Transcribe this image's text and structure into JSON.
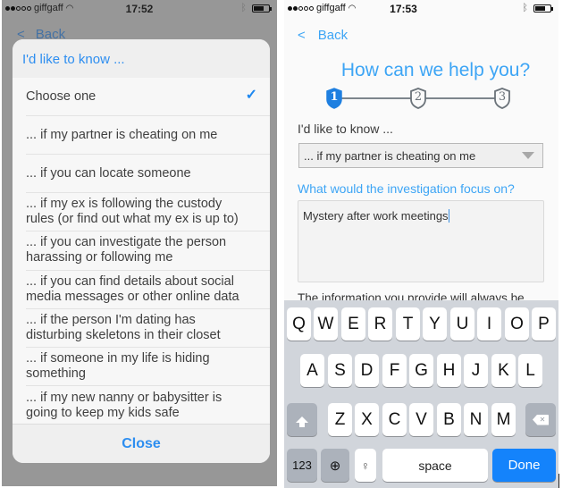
{
  "left_screen": {
    "status_bar": {
      "carrier": "giffgaff",
      "signal_bars_filled": 2,
      "signal_bars_total": 5,
      "time": "17:52"
    },
    "back_label": "Back",
    "picker": {
      "header": "I'd like to know ...",
      "options": [
        {
          "label": "Choose one",
          "selected": true
        },
        {
          "label": "... if my partner is cheating on me",
          "selected": false
        },
        {
          "label": "... if you can locate someone",
          "selected": false
        },
        {
          "label": "... if my ex is following the custody rules (or find out what my ex is up to)",
          "selected": false
        },
        {
          "label": "... if you can investigate the person harassing or following me",
          "selected": false
        },
        {
          "label": "... if you can find details about social media messages or other online data",
          "selected": false
        },
        {
          "label": "... if the person I'm dating has disturbing skeletons in their closet",
          "selected": false
        },
        {
          "label": "... if someone in my life is hiding something",
          "selected": false
        },
        {
          "label": "... if my new nanny or babysitter is going to keep my kids safe",
          "selected": false
        }
      ],
      "check_icon": "✓",
      "close_label": "Close"
    }
  },
  "right_screen": {
    "status_bar": {
      "carrier": "giffgaff",
      "signal_bars_filled": 2,
      "signal_bars_total": 5,
      "time": "17:53"
    },
    "back_label": "Back",
    "title": "How can we help you?",
    "steps": [
      {
        "number": "1",
        "active": true
      },
      {
        "number": "2",
        "active": false
      },
      {
        "number": "3",
        "active": false
      }
    ],
    "know_label": "I'd like to know ...",
    "know_select_value": "... if my partner is cheating on me",
    "focus_label": "What would the investigation focus on?",
    "focus_value": "Mystery after work meetings",
    "info_text": "The information you provide will always be",
    "keyboard": {
      "row1": [
        "Q",
        "W",
        "E",
        "R",
        "T",
        "Y",
        "U",
        "I",
        "O",
        "P"
      ],
      "row2": [
        "A",
        "S",
        "D",
        "F",
        "G",
        "H",
        "J",
        "K",
        "L"
      ],
      "row3": [
        "Z",
        "X",
        "C",
        "V",
        "B",
        "N",
        "M"
      ],
      "numbers_label": "123",
      "space_label": "space",
      "done_label": "Done",
      "globe_icon": "🌐",
      "mic_icon": "🎙",
      "shift_icon": "shift",
      "backspace_icon": "✕"
    }
  },
  "colors": {
    "accent_blue": "#3da5f5",
    "picker_blue": "#2d8ef0",
    "done_blue": "#1483fb",
    "overlay_gray": "#979797",
    "keyboard_bg": "#d1d5db"
  }
}
